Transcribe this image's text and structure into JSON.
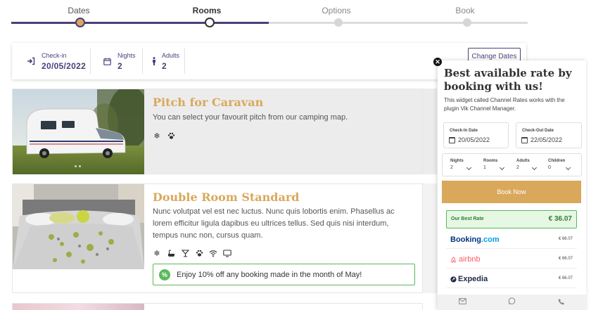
{
  "stepper": {
    "steps": [
      {
        "label": "Dates",
        "state": "done"
      },
      {
        "label": "Rooms",
        "state": "current"
      },
      {
        "label": "Options",
        "state": "todo"
      },
      {
        "label": "Book",
        "state": "todo"
      }
    ]
  },
  "summary": {
    "checkin_label": "Check-in",
    "checkin_value": "20/05/2022",
    "nights_label": "Nights",
    "nights_value": "2",
    "adults_label": "Adults",
    "adults_value": "2",
    "change_dates_label": "Change Dates"
  },
  "rooms": [
    {
      "title": "Pitch for Caravan",
      "description": "You can select your favourit pitch from our camping map.",
      "amenities": [
        "snowflake-icon",
        "paw-icon"
      ]
    },
    {
      "title": "Double Room Standard",
      "description": "Nunc volutpat vel est nec luctus. Nunc quis lobortis enim. Phasellus ac lorem efficitur ligula dapibus eu ultrices tellus. Sed quis nisi interdum, tempus nunc non, cursus quam.",
      "amenities": [
        "snowflake-icon",
        "bathtub-icon",
        "cocktail-icon",
        "paw-icon",
        "wifi-icon",
        "tv-icon"
      ],
      "promo": "Enjoy 10% off any booking made in the month of May!"
    }
  ],
  "widget": {
    "title": "Best available rate by booking with us!",
    "description": "This widget called Channel Rates works with the plugin Vik Channel Manager.",
    "checkin_label": "Check-In Date",
    "checkin_value": "20/05/2022",
    "checkout_label": "Check-Out Date",
    "checkout_value": "22/05/2022",
    "nights_label": "Nights",
    "nights_value": "2",
    "rooms_label": "Rooms",
    "rooms_value": "1",
    "adults_label": "Adults",
    "adults_value": "2",
    "children_label": "Children",
    "children_value": "0",
    "book_now_label": "Book Now",
    "best_rate_label": "Our Best Rate",
    "best_rate_value": "€ 36.07",
    "ota": [
      {
        "name": "Booking.com",
        "price": "€ 66.07"
      },
      {
        "name": "airbnb",
        "price": "€ 66.07"
      },
      {
        "name": "Expedia",
        "price": "€ 66.07"
      }
    ]
  },
  "colors": {
    "accent_gold": "#d9a85b",
    "brand_purple": "#4b3f7c",
    "success_green": "#5cb85c"
  }
}
